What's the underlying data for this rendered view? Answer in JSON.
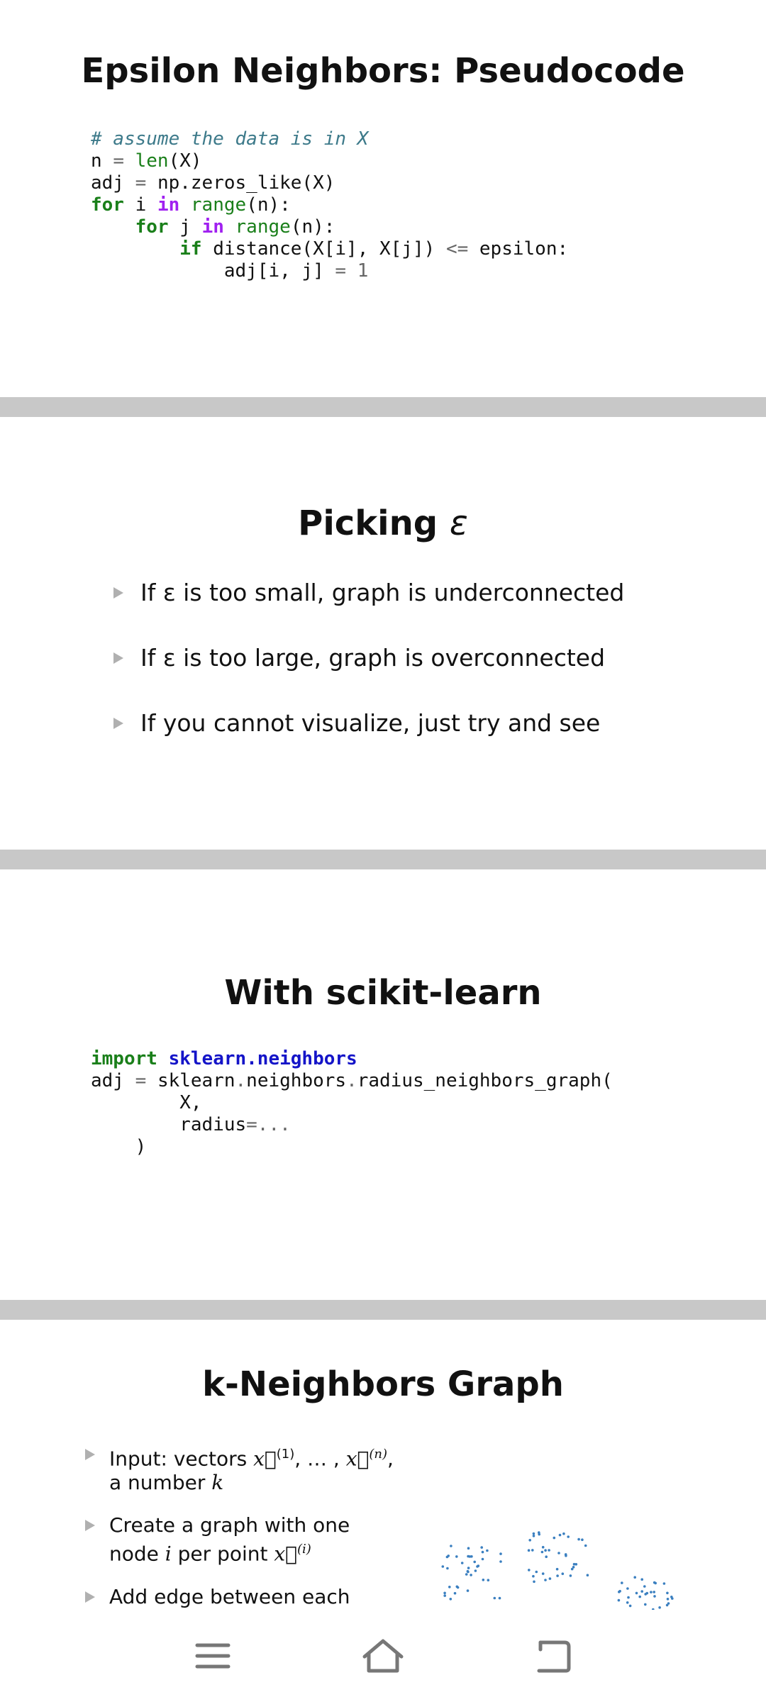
{
  "slide1": {
    "title": "Epsilon Neighbors: Pseudocode",
    "code": {
      "comment": "# assume the data is in X",
      "l2_var": "n",
      "l2_rest": "(X)",
      "l2_fn": "len",
      "l3_var": "adj",
      "l3_rest": "np.zeros_like(X)",
      "l4_for": "for",
      "l4_i": "i",
      "l4_in": "in",
      "l4_range": "range",
      "l4_rest": "(n):",
      "l5_for": "for",
      "l5_j": "j",
      "l5_in": "in",
      "l5_range": "range",
      "l5_rest": "(n):",
      "l6_if": "if",
      "l6_rest": "distance(X[i], X[j])",
      "l6_op": "<=",
      "l6_end": "epsilon:",
      "l7_rest": "adj[i, j]",
      "l7_op": "=",
      "l7_num": "1"
    }
  },
  "slide2": {
    "title_text": "Picking ",
    "title_symbol": "ε",
    "bullets": [
      "If ε is too small, graph is underconnected",
      "If ε is too large, graph is overconnected",
      "If you cannot visualize, just try and see"
    ]
  },
  "slide3": {
    "title": "With scikit-learn",
    "code": {
      "import_kw": "import",
      "module": "sklearn.neighbors",
      "l2_var": "adj",
      "l2_op": "=",
      "l2_a": "sklearn",
      "l2_b": "neighbors",
      "l2_c": "radius_neighbors_graph(",
      "l3": "X,",
      "l4_arg": "radius",
      "l4_op": "=...",
      "l5": ")"
    }
  },
  "slide4": {
    "title": "k-Neighbors Graph",
    "b1_line1": "Input: vectors ",
    "b1_vec1": "x⃗",
    "b1_sup1": "(1)",
    "b1_mid": ", … , ",
    "b1_vec2": "x⃗",
    "b1_sup2": "(n)",
    "b1_end": ",",
    "b1_line2": "a number ",
    "b1_k": "k",
    "b2_line1": "Create a graph with one",
    "b2_line2a": "node ",
    "b2_i": "i",
    "b2_line2b": " per point ",
    "b2_vec": "x⃗",
    "b2_sup": "(i)",
    "b3_line1": "Add edge between each"
  },
  "navbar": {
    "menu_icon": "menu-icon",
    "home_icon": "home-icon",
    "back_icon": "back-icon"
  },
  "colors": {
    "separator": "#c8c8c8",
    "keyword": "#1a7f1a",
    "in_keyword": "#a020f0",
    "comment": "#3d7a8a",
    "module": "#1414c8",
    "scatter_points": "#3a7fc0"
  }
}
